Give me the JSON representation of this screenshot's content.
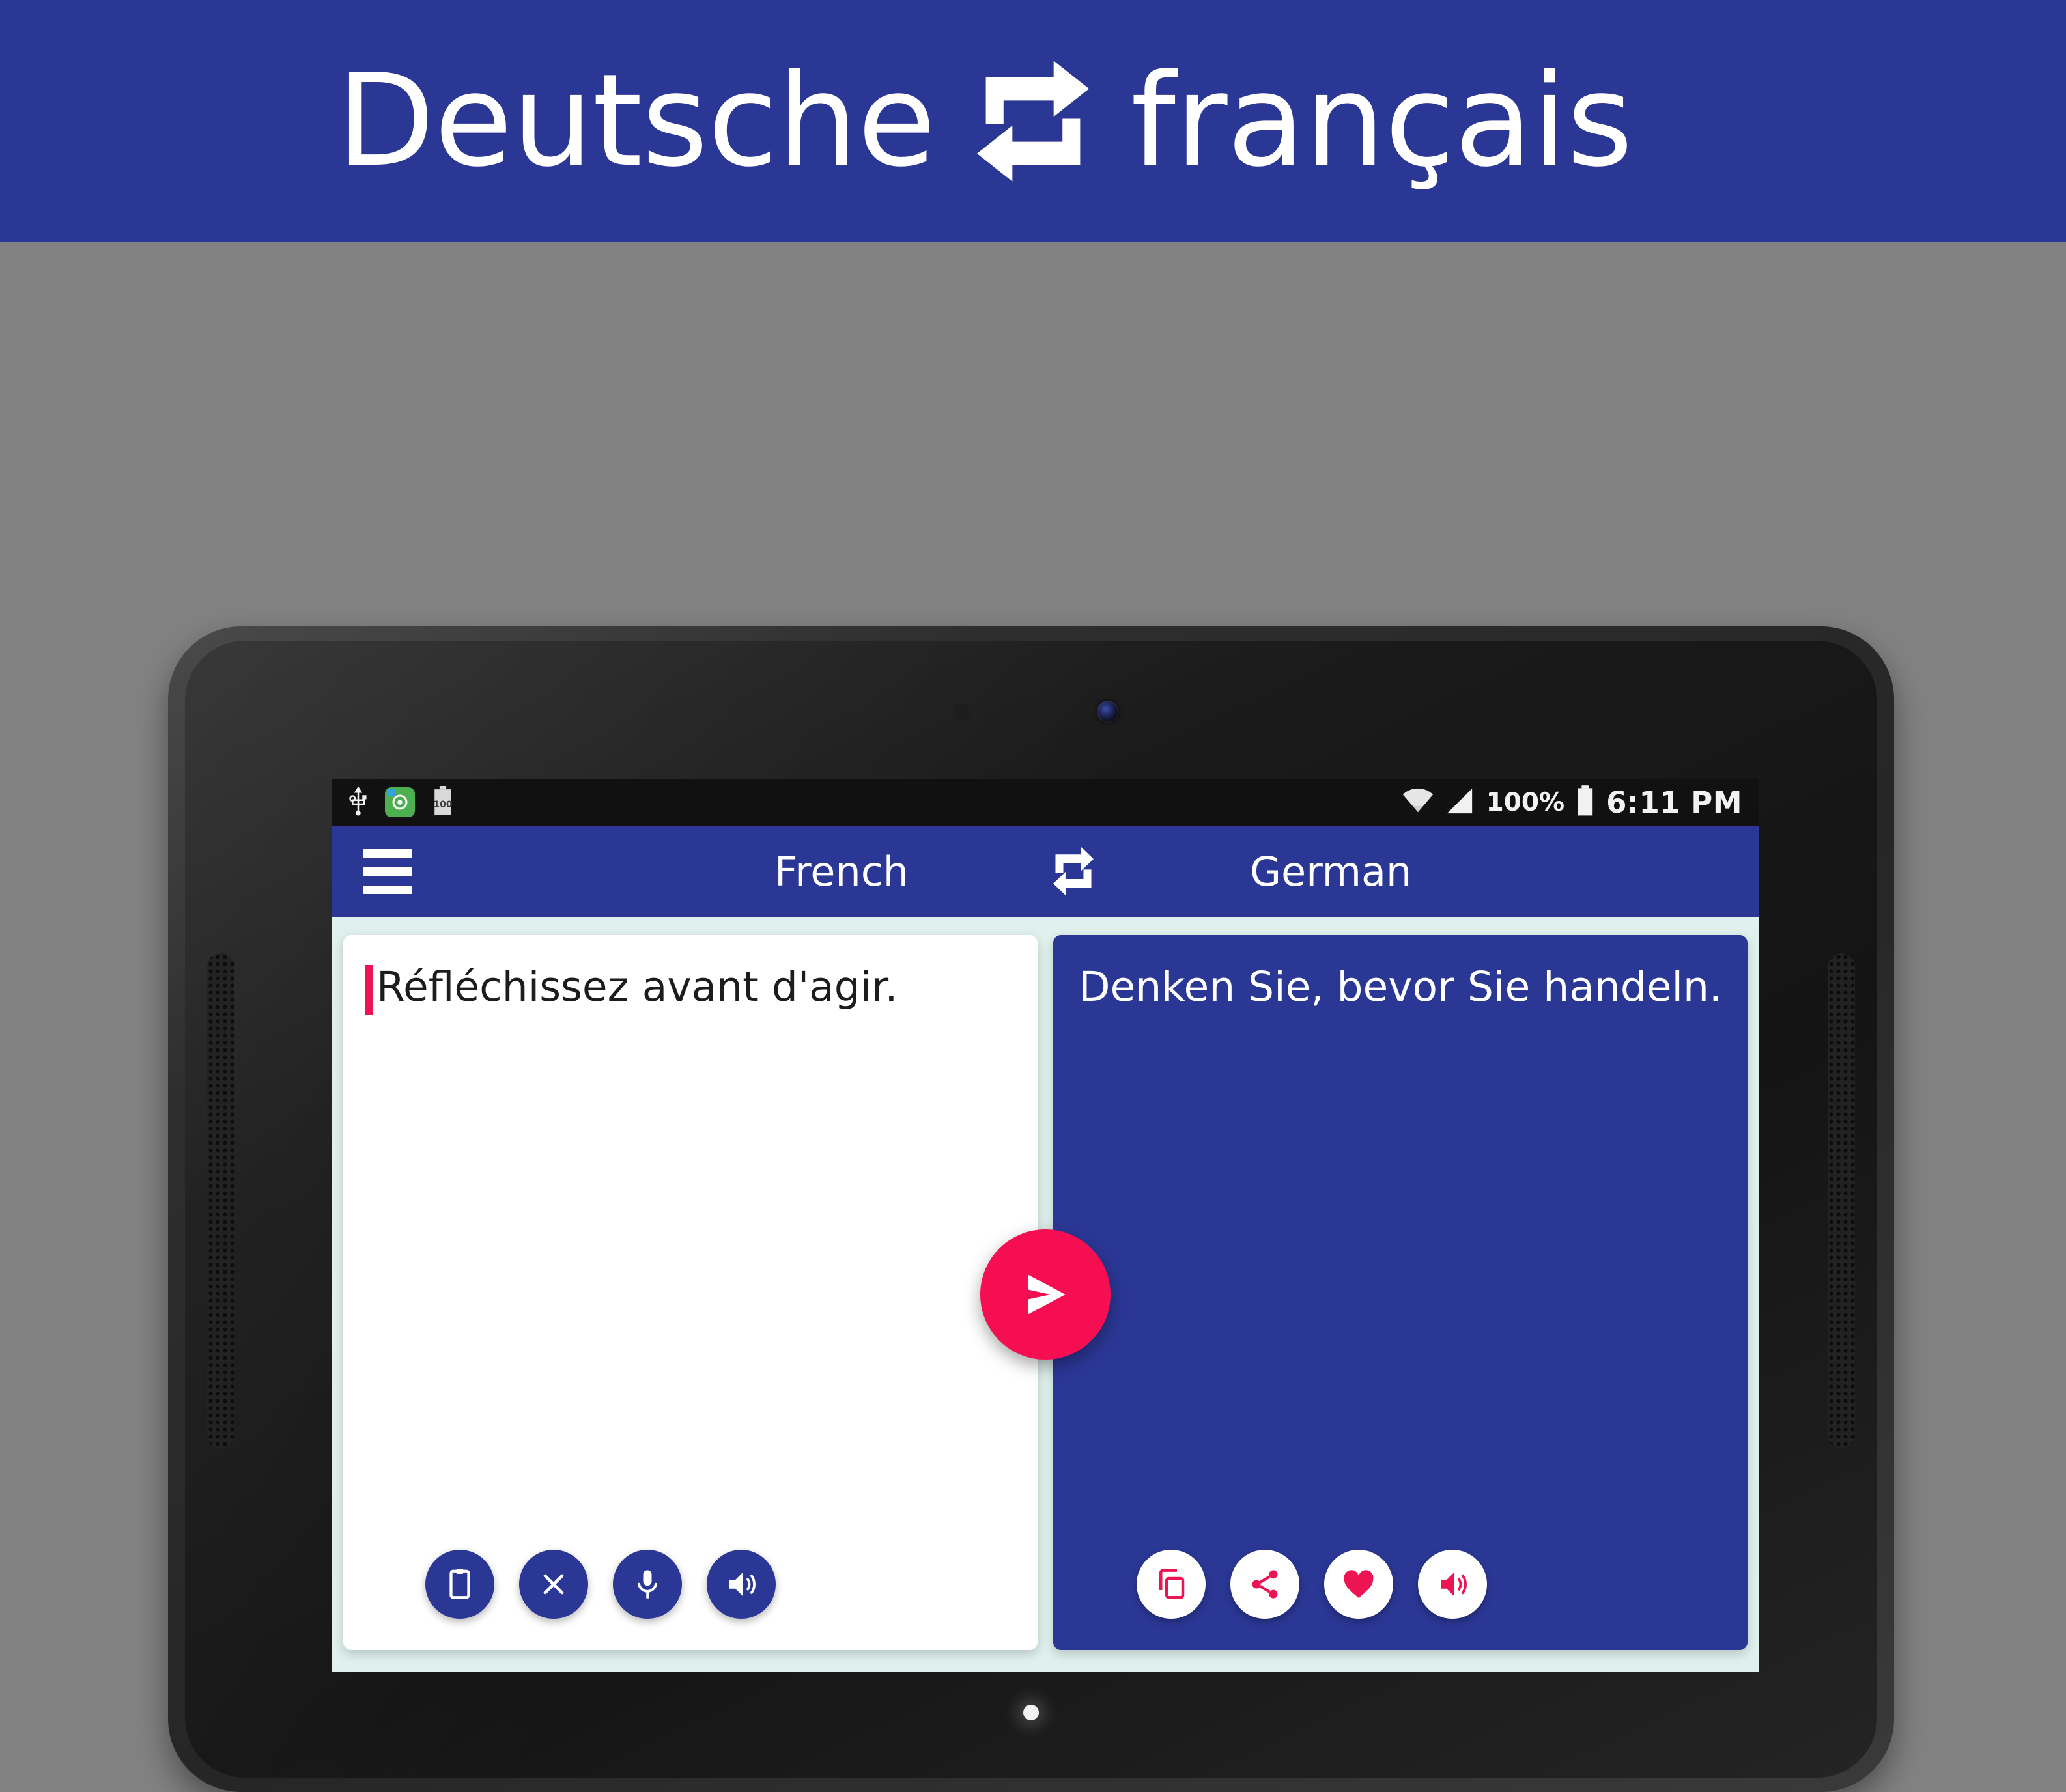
{
  "promo": {
    "left_word": "Deutsche",
    "swap_icon": "swap-arrows-icon",
    "right_word": "français",
    "banner_color": "#2b3795"
  },
  "device": {
    "type": "android-tablet",
    "frame_color": "#262626",
    "background_color": "#828282"
  },
  "status_bar": {
    "left_icons": [
      "usb-icon",
      "app-notification-icon",
      "battery-100-icon"
    ],
    "battery_label": "100",
    "right_icons": [
      "wifi-icon",
      "signal-icon",
      "battery-icon"
    ],
    "battery_percent": "100%",
    "time": "6:11 PM"
  },
  "toolbar": {
    "menu_icon": "hamburger-menu-icon",
    "source_language": "French",
    "swap_icon": "swap-languages-icon",
    "target_language": "German",
    "background_color": "#2b3795"
  },
  "source_panel": {
    "text": "Réfléchissez avant d'agir.",
    "caret_color": "#ed1453",
    "background_color": "#ffffff",
    "actions": [
      {
        "name": "paste-button",
        "icon": "clipboard-icon"
      },
      {
        "name": "clear-button",
        "icon": "close-x-icon"
      },
      {
        "name": "speak-button",
        "icon": "microphone-icon"
      },
      {
        "name": "listen-button",
        "icon": "speaker-icon"
      }
    ]
  },
  "target_panel": {
    "text": "Denken Sie, bevor Sie handeln.",
    "background_color": "#2b3795",
    "actions": [
      {
        "name": "copy-button",
        "icon": "copy-icon"
      },
      {
        "name": "share-button",
        "icon": "share-icon"
      },
      {
        "name": "favorite-button",
        "icon": "heart-icon"
      },
      {
        "name": "listen-button",
        "icon": "speaker-icon"
      }
    ]
  },
  "translate_button": {
    "name": "translate-button",
    "icon": "send-arrow-icon",
    "color": "#f50f52"
  },
  "screen_background_color": "#dff0ed"
}
